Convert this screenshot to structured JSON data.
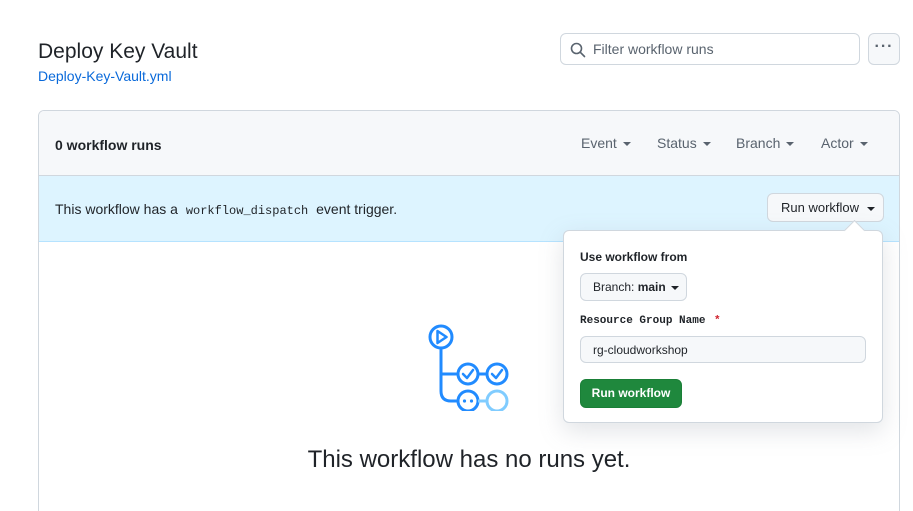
{
  "header": {
    "title": "Deploy Key Vault",
    "file_link": "Deploy-Key-Vault.yml",
    "search_placeholder": "Filter workflow runs",
    "more_label": "···"
  },
  "runs_panel": {
    "count_label": "0 workflow runs",
    "filters": [
      "Event",
      "Status",
      "Branch",
      "Actor"
    ]
  },
  "dispatch": {
    "text_before": "This workflow has a",
    "code": "workflow_dispatch",
    "text_after": "event trigger.",
    "run_button_label": "Run workflow"
  },
  "popover": {
    "use_from_label": "Use workflow from",
    "branch_prefix": "Branch:",
    "branch_name": "main",
    "field_label": "Resource Group Name",
    "required_mark": "*",
    "field_value": "rg-cloudworkshop",
    "submit_label": "Run workflow"
  },
  "empty_state": {
    "title": "This workflow has no runs yet."
  },
  "colors": {
    "accent_blue": "#0969da",
    "dispatch_bg": "#ddf4ff",
    "primary_green": "#1f883d",
    "danger": "#cf222e"
  }
}
